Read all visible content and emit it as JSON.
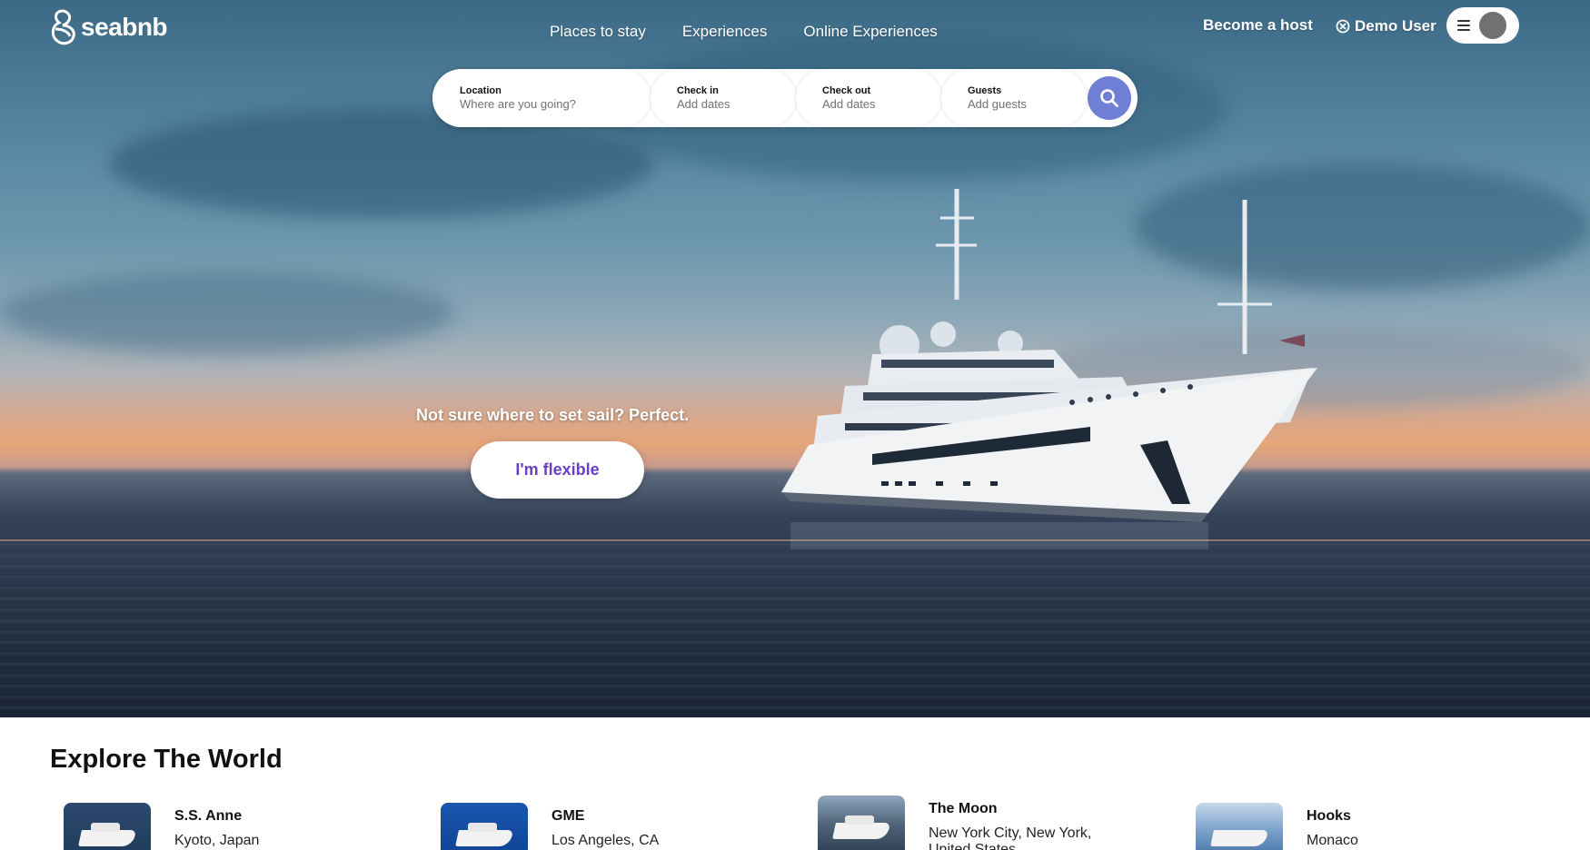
{
  "brand": {
    "name": "seabnb"
  },
  "nav": {
    "links": [
      "Places to stay",
      "Experiences",
      "Online Experiences"
    ],
    "become_host": "Become a host",
    "user": "Demo User"
  },
  "search": {
    "location": {
      "label": "Location",
      "placeholder": "Where are you going?"
    },
    "checkin": {
      "label": "Check in",
      "placeholder": "Add dates"
    },
    "checkout": {
      "label": "Check out",
      "placeholder": "Add dates"
    },
    "guests": {
      "label": "Guests",
      "placeholder": "Add guests"
    }
  },
  "hero": {
    "tagline": "Not sure where to set sail? Perfect.",
    "cta": "I'm flexible"
  },
  "explore": {
    "title": "Explore The World",
    "cards": [
      {
        "title": "S.S. Anne",
        "subtitle": "Kyoto, Japan"
      },
      {
        "title": "GME",
        "subtitle": "Los Angeles, CA"
      },
      {
        "title": "The Moon",
        "subtitle": "New York City, New York, United States"
      },
      {
        "title": "Hooks",
        "subtitle": "Monaco"
      }
    ]
  },
  "colors": {
    "accent": "#6f7fd6",
    "cta_text": "#6a3fc8",
    "avatar": "#717171"
  },
  "icons": {
    "logo": "seabnb-logo-icon",
    "user": "user-x-circle-icon",
    "menu": "hamburger-menu-icon",
    "search": "search-icon"
  }
}
